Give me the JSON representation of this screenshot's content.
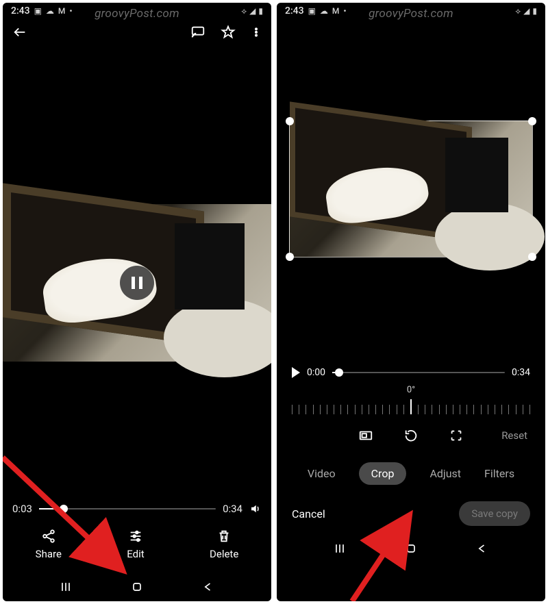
{
  "watermark": "groovyPost.com",
  "status": {
    "time": "2:43",
    "battery_icon": "battery-icon",
    "signal_icon": "signal-icon",
    "wifi_icon": "wifi-icon"
  },
  "left": {
    "play_position": "0:03",
    "duration": "0:34",
    "progress_pct": 14,
    "actions": {
      "share": "Share",
      "edit": "Edit",
      "delete": "Delete"
    }
  },
  "right": {
    "play_position": "0:00",
    "duration": "0:34",
    "progress_pct": 4,
    "rotation_label": "0°",
    "reset_label": "Reset",
    "tabs": [
      "Video",
      "Crop",
      "Adjust",
      "Filters"
    ],
    "active_tab": "Crop",
    "cancel": "Cancel",
    "save": "Save copy"
  }
}
